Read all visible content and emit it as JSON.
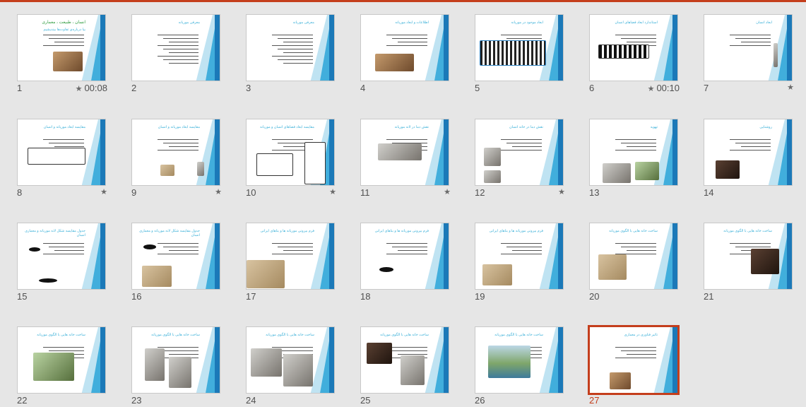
{
  "colors": {
    "selection": "#c43e1c",
    "title_blue": "#3ab0d8",
    "background": "#e6e6e6"
  },
  "slides": [
    {
      "number": "1",
      "title": "انسان ، طبیعت ، معماری",
      "subtitle": "بیا درباره‌ی تفاوت‌ها بیندیشیم",
      "star": true,
      "timing": "00:08"
    },
    {
      "number": "2",
      "title": "معرفی موریانه",
      "star": false,
      "timing": ""
    },
    {
      "number": "3",
      "title": "معرفی موریانه",
      "star": false,
      "timing": ""
    },
    {
      "number": "4",
      "title": "اطلاعات و ابعاد موریانه",
      "star": false,
      "timing": ""
    },
    {
      "number": "5",
      "title": "ابعاد موجود در موریانه",
      "star": false,
      "timing": ""
    },
    {
      "number": "6",
      "title": "استاندارد ابعاد فضاهای انسان",
      "star": true,
      "timing": "00:10"
    },
    {
      "number": "7",
      "title": "ابعاد انسان",
      "star": true,
      "timing": ""
    },
    {
      "number": "8",
      "title": "مقایسه ابعاد موریانه و انسان",
      "star": true,
      "timing": ""
    },
    {
      "number": "9",
      "title": "مقایسه ابعاد موریانه و انسان",
      "star": true,
      "timing": ""
    },
    {
      "number": "10",
      "title": "مقایسه ابعاد فضاهای انسان و موریانه",
      "star": true,
      "timing": ""
    },
    {
      "number": "11",
      "title": "نقش دما در لانه موریانه",
      "star": true,
      "timing": ""
    },
    {
      "number": "12",
      "title": "نقش دما در خانه انسان",
      "star": true,
      "timing": ""
    },
    {
      "number": "13",
      "title": "تهویه",
      "star": false,
      "timing": ""
    },
    {
      "number": "14",
      "title": "روشنایی",
      "star": false,
      "timing": ""
    },
    {
      "number": "15",
      "title": "جدول مقایسه شکل لانه موریانه و معماری انسان",
      "star": false,
      "timing": ""
    },
    {
      "number": "16",
      "title": "جدول مقایسه شکل لانه موریانه و معماری انسان",
      "star": false,
      "timing": ""
    },
    {
      "number": "17",
      "title": "فرم بیرونی موریانه ها و بناهای ایرانی",
      "star": false,
      "timing": ""
    },
    {
      "number": "18",
      "title": "فرم بیرونی موریانه ها و بناهای ایرانی",
      "star": false,
      "timing": ""
    },
    {
      "number": "19",
      "title": "فرم بیرونی موریانه ها و بناهای ایرانی",
      "star": false,
      "timing": ""
    },
    {
      "number": "20",
      "title": "ساخت خانه هایی با الگوی موریانه",
      "star": false,
      "timing": ""
    },
    {
      "number": "21",
      "title": "ساخت خانه هایی با الگوی موریانه",
      "star": false,
      "timing": ""
    },
    {
      "number": "22",
      "title": "ساخت خانه هایی با الگوی موریانه",
      "star": false,
      "timing": ""
    },
    {
      "number": "23",
      "title": "ساخت خانه هایی با الگوی موریانه",
      "star": false,
      "timing": ""
    },
    {
      "number": "24",
      "title": "ساخت خانه هایی با الگوی موریانه",
      "star": false,
      "timing": ""
    },
    {
      "number": "25",
      "title": "ساخت خانه هایی با الگوی موریانه",
      "star": false,
      "timing": ""
    },
    {
      "number": "26",
      "title": "ساخت خانه هایی با الگوی موریانه",
      "star": false,
      "timing": ""
    },
    {
      "number": "27",
      "title": "تاثیر فناوری در معماری",
      "star": false,
      "timing": "",
      "selected": true
    }
  ]
}
